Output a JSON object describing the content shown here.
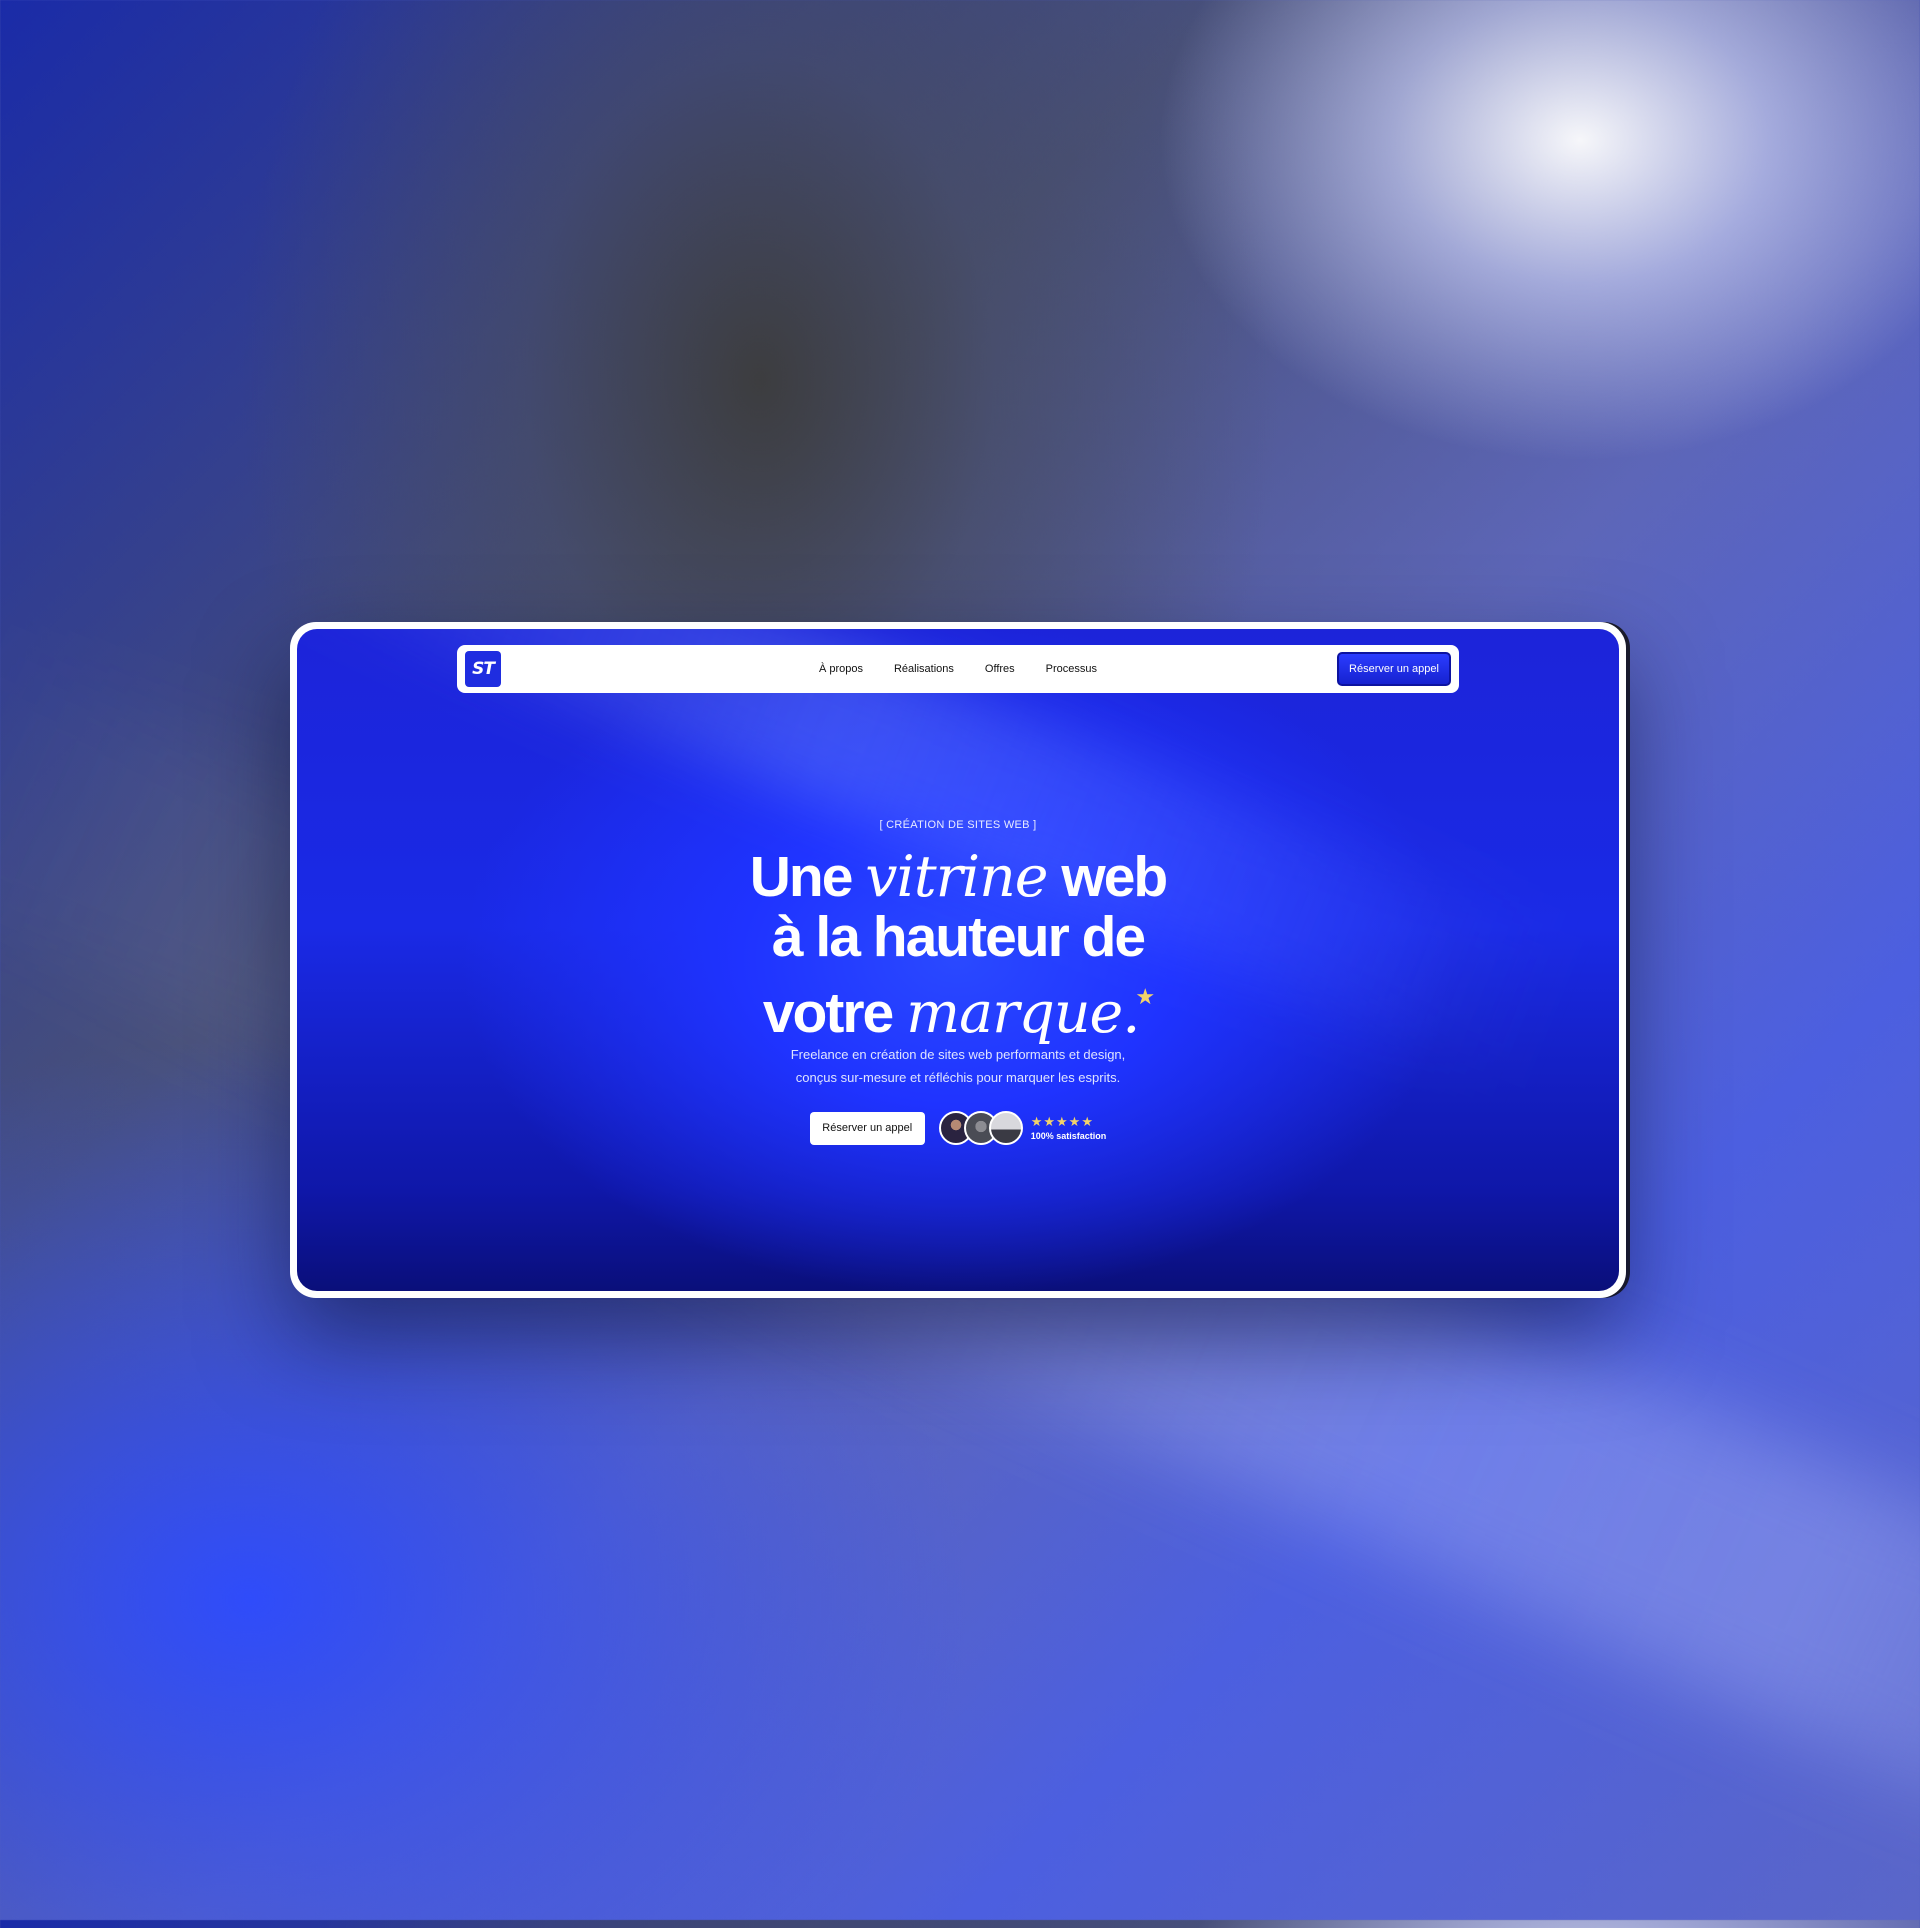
{
  "nav": {
    "logo_text": "ST",
    "links": [
      "À propos",
      "Réalisations",
      "Offres",
      "Processus"
    ],
    "cta_label": "Réserver un appel"
  },
  "hero": {
    "eyebrow": "[  CRÉATION DE SITES WEB  ]",
    "headline": {
      "line1_a": "Une ",
      "line1_b": "vitrine",
      "line1_c": " web",
      "line2": "à la hauteur de",
      "line3_a": "votre ",
      "line3_b": "marque.",
      "star": "★"
    },
    "subtitle_line1": "Freelance en création de sites web performants et design,",
    "subtitle_line2": "conçus sur-mesure et réfléchis pour marquer les esprits.",
    "cta_label": "Réserver un appel",
    "rating": {
      "stars": "★★★★★",
      "value": 5,
      "max": 5,
      "label": "100% satisfaction"
    }
  },
  "colors": {
    "brand_blue": "#1f2de0",
    "star_yellow": "#f2d36b"
  }
}
